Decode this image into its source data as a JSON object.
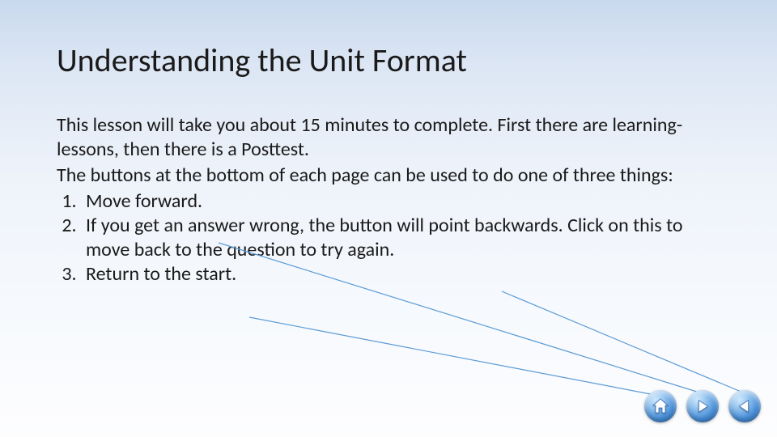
{
  "slide": {
    "title": "Understanding the Unit Format",
    "intro1": "This lesson will take you about 15 minutes to complete.  First there are learning-lessons, then there is a Posttest.",
    "intro2": "The buttons at the bottom of each page can be used to do one of three things:",
    "items": {
      "i1": "Move forward.",
      "i2": "If you get an answer wrong, the button will point backwards.  Click on this to move back to the question to try again.",
      "i3": "Return to the start."
    }
  },
  "nav": {
    "home": "home",
    "forward": "forward",
    "back": "back"
  }
}
